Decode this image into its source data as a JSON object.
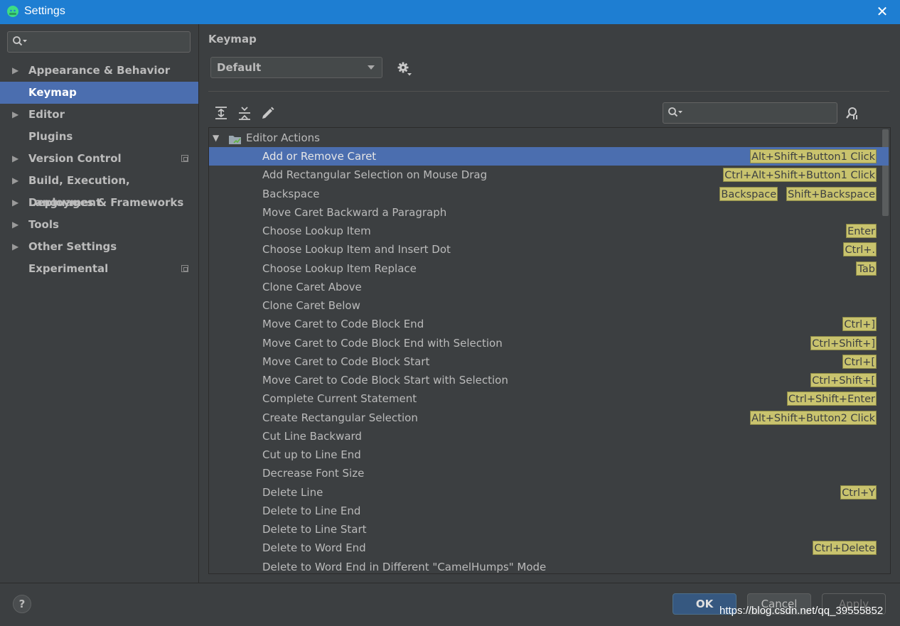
{
  "window": {
    "title": "Settings"
  },
  "sidebar": {
    "search_placeholder": "",
    "items": [
      {
        "label": "Appearance & Behavior",
        "expandable": true,
        "selected": false
      },
      {
        "label": "Keymap",
        "expandable": false,
        "selected": true
      },
      {
        "label": "Editor",
        "expandable": true,
        "selected": false
      },
      {
        "label": "Plugins",
        "expandable": false,
        "selected": false
      },
      {
        "label": "Version Control",
        "expandable": true,
        "selected": false,
        "project_icon": true
      },
      {
        "label": "Build, Execution, Deployment",
        "expandable": true,
        "selected": false
      },
      {
        "label": "Languages & Frameworks",
        "expandable": true,
        "selected": false
      },
      {
        "label": "Tools",
        "expandable": true,
        "selected": false
      },
      {
        "label": "Other Settings",
        "expandable": true,
        "selected": false
      },
      {
        "label": "Experimental",
        "expandable": false,
        "selected": false,
        "project_icon": true
      }
    ]
  },
  "main": {
    "heading": "Keymap",
    "scheme": "Default",
    "search_placeholder": "",
    "tree": {
      "group": "Editor Actions",
      "rows": [
        {
          "label": "Add or Remove Caret",
          "keys": [
            "Alt+Shift+Button1 Click"
          ],
          "selected": true
        },
        {
          "label": "Add Rectangular Selection on Mouse Drag",
          "keys": [
            "Ctrl+Alt+Shift+Button1 Click"
          ]
        },
        {
          "label": "Backspace",
          "keys": [
            "Backspace",
            "Shift+Backspace"
          ]
        },
        {
          "label": "Move Caret Backward a Paragraph",
          "keys": []
        },
        {
          "label": "Choose Lookup Item",
          "keys": [
            "Enter"
          ]
        },
        {
          "label": "Choose Lookup Item and Insert Dot",
          "keys": [
            "Ctrl+."
          ]
        },
        {
          "label": "Choose Lookup Item Replace",
          "keys": [
            "Tab"
          ]
        },
        {
          "label": "Clone Caret Above",
          "keys": []
        },
        {
          "label": "Clone Caret Below",
          "keys": []
        },
        {
          "label": "Move Caret to Code Block End",
          "keys": [
            "Ctrl+]"
          ]
        },
        {
          "label": "Move Caret to Code Block End with Selection",
          "keys": [
            "Ctrl+Shift+]"
          ]
        },
        {
          "label": "Move Caret to Code Block Start",
          "keys": [
            "Ctrl+["
          ]
        },
        {
          "label": "Move Caret to Code Block Start with Selection",
          "keys": [
            "Ctrl+Shift+["
          ]
        },
        {
          "label": "Complete Current Statement",
          "keys": [
            "Ctrl+Shift+Enter"
          ]
        },
        {
          "label": "Create Rectangular Selection",
          "keys": [
            "Alt+Shift+Button2 Click"
          ]
        },
        {
          "label": "Cut Line Backward",
          "keys": []
        },
        {
          "label": "Cut up to Line End",
          "keys": []
        },
        {
          "label": "Decrease Font Size",
          "keys": []
        },
        {
          "label": "Delete Line",
          "keys": [
            "Ctrl+Y"
          ]
        },
        {
          "label": "Delete to Line End",
          "keys": []
        },
        {
          "label": "Delete to Line Start",
          "keys": []
        },
        {
          "label": "Delete to Word End",
          "keys": [
            "Ctrl+Delete"
          ]
        },
        {
          "label": "Delete to Word End in Different \"CamelHumps\" Mode",
          "keys": []
        }
      ]
    }
  },
  "footer": {
    "help": "?",
    "ok": "OK",
    "cancel": "Cancel",
    "apply": "Apply",
    "watermark": "https://blog.csdn.net/qq_39555852"
  },
  "colors": {
    "accent": "#1e7ed2",
    "selection": "#4b6eaf",
    "shortcut_badge": "#c9c36e",
    "background": "#3c3f41"
  },
  "icons": [
    "android-icon",
    "close-icon",
    "search-icon",
    "gear-icon",
    "expand-all-icon",
    "collapse-all-icon",
    "edit-icon",
    "find-shortcut-icon",
    "folder-icon",
    "help-icon"
  ]
}
